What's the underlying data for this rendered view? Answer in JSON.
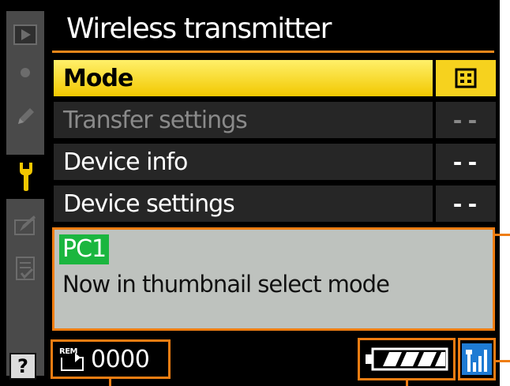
{
  "title": "Wireless transmitter",
  "colors": {
    "accent": "#ef7d12",
    "selected_row": "#f6d21e",
    "badge_green": "#1bb63f",
    "panel_bg": "#bec2be"
  },
  "sidebar": {
    "items": [
      {
        "icon": "playback-icon"
      },
      {
        "icon": "camera-icon"
      },
      {
        "icon": "pencil-icon"
      },
      {
        "icon": "wrench-icon",
        "active": true
      },
      {
        "icon": "retouch-icon"
      },
      {
        "icon": "my-menu-icon"
      }
    ],
    "help_label": "?"
  },
  "menu": {
    "items": [
      {
        "label": "Mode",
        "value": "⊞",
        "state": "selected"
      },
      {
        "label": "Transfer settings",
        "value": "--",
        "state": "disabled"
      },
      {
        "label": "Device info",
        "value": "--",
        "state": "normal"
      },
      {
        "label": "Device settings",
        "value": "--",
        "state": "normal"
      }
    ]
  },
  "info": {
    "badge": "PC1",
    "message": "Now in thumbnail select mode"
  },
  "status": {
    "rem_label": "REM",
    "rem_count": "0000",
    "battery_icon": "battery-full-icon",
    "signal_icon": "signal-strength-icon"
  }
}
